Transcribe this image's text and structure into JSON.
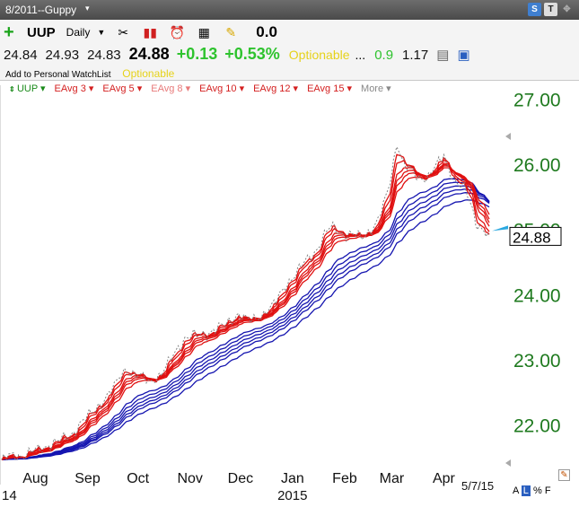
{
  "titlebar": {
    "title": "8/2011--Guppy"
  },
  "header": {
    "symbol": "UUP",
    "period": "Daily",
    "change_top": "0.0",
    "quote": {
      "open": "24.84",
      "high": "24.93",
      "low": "24.83",
      "last": "24.88",
      "change": "+0.13",
      "change_pct": "+0.53%",
      "optionable": "Optionable",
      "dots": "...",
      "val1": "0.9",
      "val2": "1.17"
    },
    "watchlist": "Add to Personal WatchList",
    "optionable2": "Optionable"
  },
  "legend": [
    {
      "label": "UUP",
      "color": "#1a8a1a"
    },
    {
      "label": "EAvg 3",
      "color": "#d42020"
    },
    {
      "label": "EAvg 5",
      "color": "#d42020"
    },
    {
      "label": "EAvg 8",
      "color": "#e87a7a"
    },
    {
      "label": "EAvg 10",
      "color": "#d42020"
    },
    {
      "label": "EAvg 12",
      "color": "#d42020"
    },
    {
      "label": "EAvg 15",
      "color": "#d42020"
    },
    {
      "label": "More",
      "color": "#888888"
    }
  ],
  "chart_data": {
    "type": "line",
    "ylim": [
      21.4,
      27.2
    ],
    "y_ticks": [
      "27.00",
      "26.00",
      "25.00",
      "24.00",
      "23.00",
      "22.00"
    ],
    "x_ticks": [
      "Aug",
      "Sep",
      "Oct",
      "Nov",
      "Dec",
      "Jan",
      "Feb",
      "Mar",
      "Apr"
    ],
    "x_sub_labels": [
      "14",
      "2015"
    ],
    "end_date": "5/7/15",
    "last_price": "24.88",
    "colors": {
      "price": "#808080",
      "short": "#e01010",
      "long": "#1515b0",
      "axis_text": "#1f7a1f"
    },
    "price": [
      {
        "x": "Jul 21",
        "y": 21.45
      },
      {
        "x": "Aug 1",
        "y": 21.52
      },
      {
        "x": "Aug 15",
        "y": 21.63
      },
      {
        "x": "Sep 1",
        "y": 21.85
      },
      {
        "x": "Sep 15",
        "y": 22.25
      },
      {
        "x": "Sep 26",
        "y": 22.55
      },
      {
        "x": "Oct 3",
        "y": 22.88
      },
      {
        "x": "Oct 10",
        "y": 22.72
      },
      {
        "x": "Oct 17",
        "y": 22.65
      },
      {
        "x": "Oct 24",
        "y": 22.78
      },
      {
        "x": "Nov 1",
        "y": 23.08
      },
      {
        "x": "Nov 8",
        "y": 23.35
      },
      {
        "x": "Nov 20",
        "y": 23.38
      },
      {
        "x": "Dec 1",
        "y": 23.52
      },
      {
        "x": "Dec 8",
        "y": 23.7
      },
      {
        "x": "Dec 15",
        "y": 23.55
      },
      {
        "x": "Dec 31",
        "y": 23.85
      },
      {
        "x": "Jan 9",
        "y": 24.25
      },
      {
        "x": "Jan 23",
        "y": 24.62
      },
      {
        "x": "Feb 1",
        "y": 25.05
      },
      {
        "x": "Feb 10",
        "y": 24.9
      },
      {
        "x": "Feb 20",
        "y": 24.88
      },
      {
        "x": "Mar 1",
        "y": 25.05
      },
      {
        "x": "Mar 8",
        "y": 25.55
      },
      {
        "x": "Mar 13",
        "y": 26.35
      },
      {
        "x": "Mar 18",
        "y": 25.95
      },
      {
        "x": "Mar 25",
        "y": 25.78
      },
      {
        "x": "Apr 1",
        "y": 25.82
      },
      {
        "x": "Apr 10",
        "y": 26.1
      },
      {
        "x": "Apr 16",
        "y": 25.75
      },
      {
        "x": "Apr 23",
        "y": 25.6
      },
      {
        "x": "Apr 30",
        "y": 25.05
      },
      {
        "x": "May 7",
        "y": 24.88
      }
    ]
  }
}
